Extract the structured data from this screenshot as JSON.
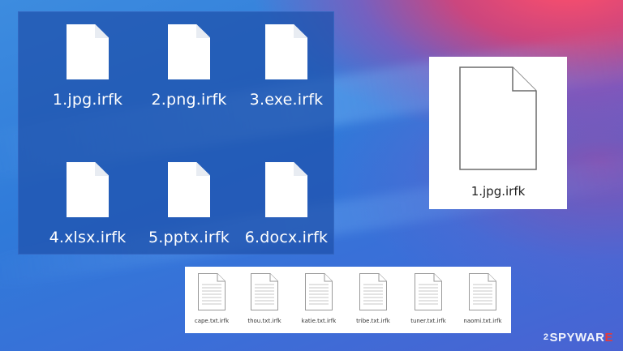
{
  "icon_grid": {
    "files": [
      {
        "name": "1.jpg.irfk"
      },
      {
        "name": "2.png.irfk"
      },
      {
        "name": "3.exe.irfk"
      },
      {
        "name": "4.xlsx.irfk"
      },
      {
        "name": "5.pptx.irfk"
      },
      {
        "name": "6.docx.irfk"
      }
    ]
  },
  "preview": {
    "name": "1.jpg.irfk"
  },
  "text_files": {
    "files": [
      {
        "name": "cape.txt.irfk"
      },
      {
        "name": "thou.txt.irfk"
      },
      {
        "name": "katie.txt.irfk"
      },
      {
        "name": "tribe.txt.irfk"
      },
      {
        "name": "tuner.txt.irfk"
      },
      {
        "name": "naomi.txt.irfk"
      }
    ]
  },
  "watermark": {
    "num": "2",
    "text_a": "SPYWAR",
    "text_b": "E"
  },
  "colors": {
    "panel": "#1e50aa",
    "watermark_accent": "#e53a3a"
  }
}
